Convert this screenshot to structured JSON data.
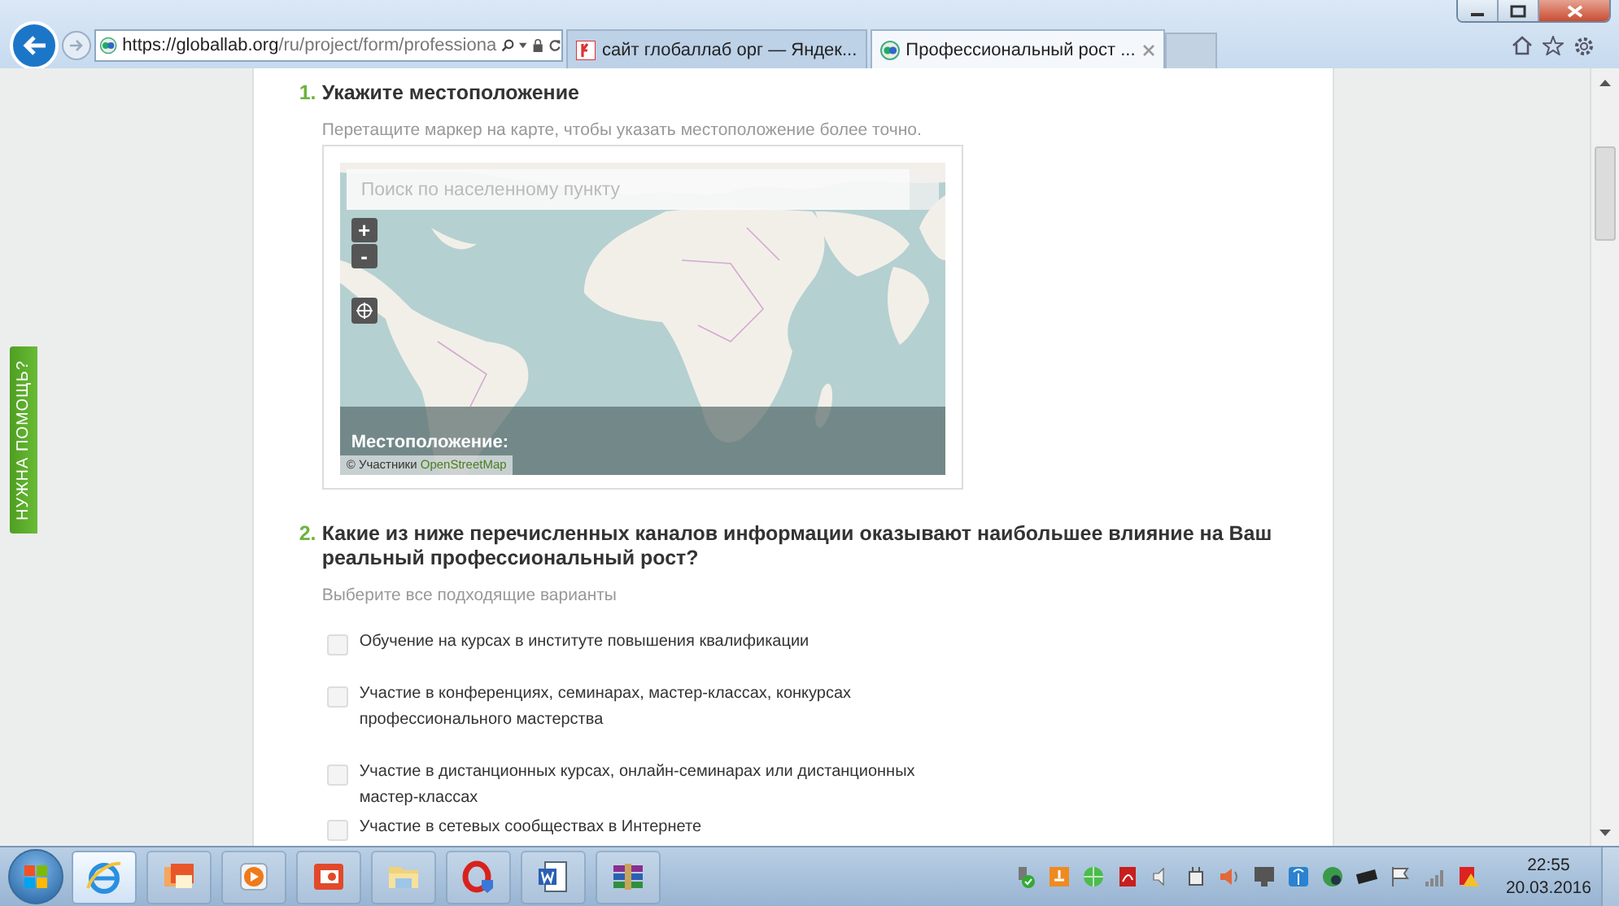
{
  "browser": {
    "address_host": "https://globallab.org",
    "address_path": "/ru/project/form/professiona",
    "tabs": [
      {
        "title": "сайт глобаллаб орг — Яндек...",
        "selected": false,
        "kind": "yandex"
      },
      {
        "title": "Профессиональный рост ...",
        "selected": true,
        "kind": "site"
      }
    ]
  },
  "help_tab": "НУЖНА ПОМОЩЬ?",
  "questions": [
    {
      "kind": "map",
      "number": "1.",
      "title": "Укажите местоположение",
      "hint": "Перетащите маркер на карте, чтобы указать местоположение более точно.",
      "map": {
        "search_placeholder": "Поиск по населенному пункту",
        "zoom_in": "+",
        "zoom_out": "-",
        "location_label": "Местоположение:",
        "attribution": "© Участники",
        "attribution_link": "OpenStreetMap"
      }
    },
    {
      "kind": "checklist",
      "number": "2.",
      "title": "Какие из ниже перечисленных каналов информации оказывают наибольшее влияние на Ваш реальный профессиональный рост?",
      "hint": "Выберите все подходящие варианты",
      "options": [
        {
          "label": "Обучение на курсах в институте повышения квалификации",
          "checked": false
        },
        {
          "label": "Участие в конференциях, семинарах, мастер-классах, конкурсах профессионального мастерства",
          "checked": false
        },
        {
          "label": "Участие в дистанционных курсах, онлайн-семинарах или дистанционных мастер-классах",
          "checked": false
        },
        {
          "label": "Участие в сетевых сообществах в Интернете",
          "checked": false
        }
      ]
    }
  ],
  "taskbar": {
    "apps": [
      {
        "kind": "browser",
        "selected": true
      },
      {
        "kind": "photos",
        "selected": false
      },
      {
        "kind": "player",
        "selected": false
      },
      {
        "kind": "slides",
        "selected": false
      },
      {
        "kind": "folder",
        "selected": false
      },
      {
        "kind": "opera",
        "selected": false
      },
      {
        "kind": "word",
        "selected": false
      },
      {
        "kind": "archive",
        "selected": false
      }
    ],
    "time": "22:55",
    "date": "20.03.2016"
  }
}
